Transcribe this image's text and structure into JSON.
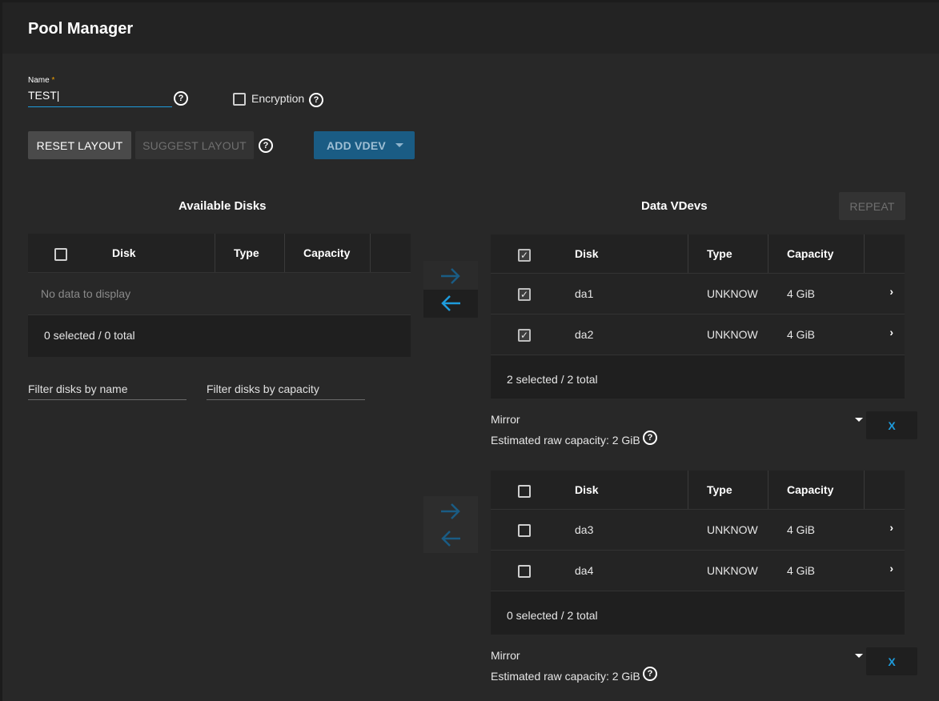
{
  "header": {
    "title": "Pool Manager"
  },
  "name_field": {
    "label": "Name",
    "required_mark": "*",
    "value": "TEST"
  },
  "encryption": {
    "label": "Encryption",
    "checked": false
  },
  "buttons": {
    "reset_layout": "RESET LAYOUT",
    "suggest_layout": "SUGGEST LAYOUT",
    "add_vdev": "ADD VDEV",
    "repeat": "REPEAT"
  },
  "available_disks": {
    "title": "Available Disks",
    "columns": [
      "Disk",
      "Type",
      "Capacity"
    ],
    "empty_text": "No data to display",
    "footer": "0 selected / 0 total",
    "filters": {
      "name": "Filter disks by name",
      "capacity": "Filter disks by capacity"
    }
  },
  "data_vdevs": {
    "title": "Data VDevs",
    "groups": [
      {
        "columns": [
          "Disk",
          "Type",
          "Capacity"
        ],
        "header_checked": true,
        "rows": [
          {
            "disk": "da1",
            "type": "UNKNOW",
            "capacity": "4 GiB",
            "checked": true
          },
          {
            "disk": "da2",
            "type": "UNKNOW",
            "capacity": "4 GiB",
            "checked": true
          }
        ],
        "footer": "2 selected / 2 total",
        "layout": "Mirror",
        "estimated": "Estimated raw capacity: 2 GiB",
        "remove_label": "X"
      },
      {
        "columns": [
          "Disk",
          "Type",
          "Capacity"
        ],
        "header_checked": false,
        "rows": [
          {
            "disk": "da3",
            "type": "UNKNOW",
            "capacity": "4 GiB",
            "checked": false
          },
          {
            "disk": "da4",
            "type": "UNKNOW",
            "capacity": "4 GiB",
            "checked": false
          }
        ],
        "footer": "0 selected / 2 total",
        "layout": "Mirror",
        "estimated": "Estimated raw capacity: 2 GiB",
        "remove_label": "X"
      }
    ]
  },
  "icons": {
    "help": "?",
    "check": "✓",
    "chevron": "›"
  },
  "colors": {
    "accent": "#1e9bdc",
    "add_vdev_bg": "#1a5c84",
    "required": "#f0a000"
  }
}
